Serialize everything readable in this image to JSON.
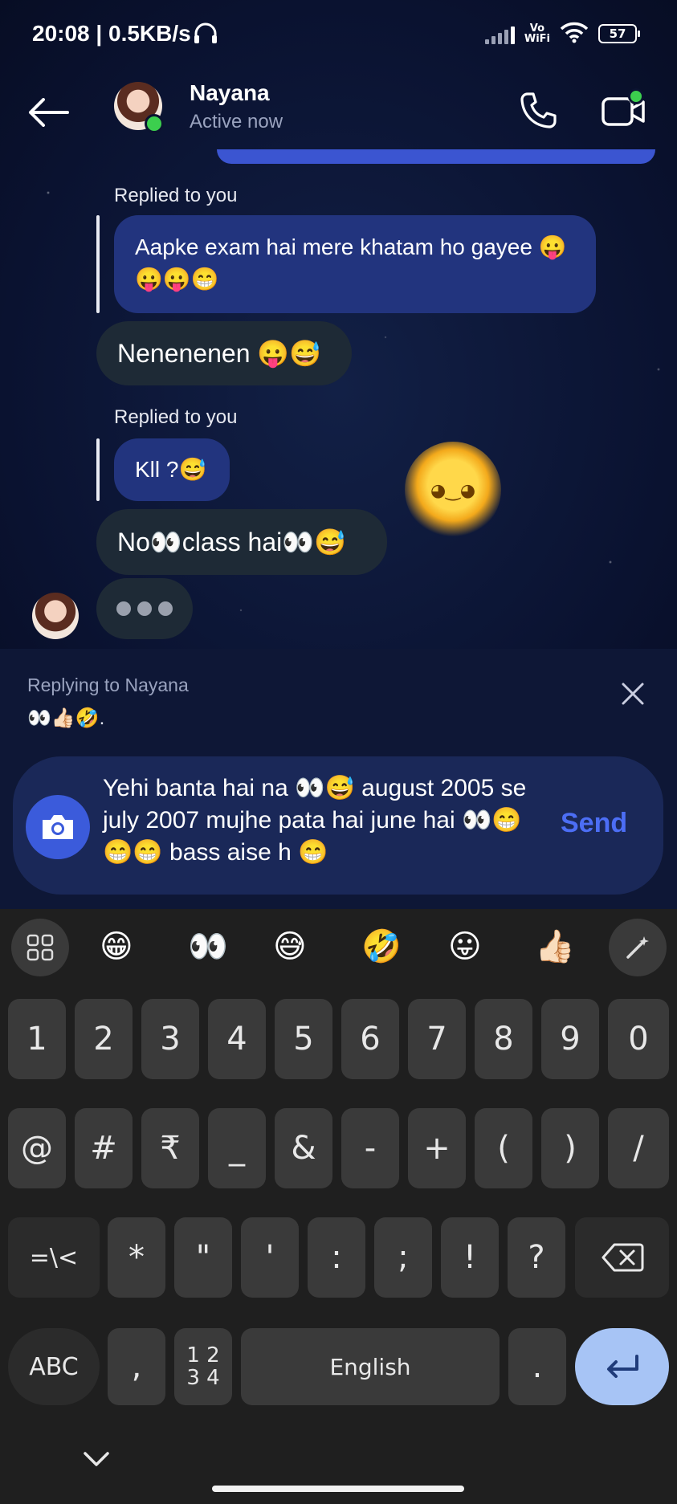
{
  "status_bar": {
    "time": "20:08 | 0.5KB/s",
    "vowifi_top": "Vo",
    "vowifi_bottom": "WiFi",
    "battery": "57"
  },
  "header": {
    "contact_name": "Nayana",
    "contact_status": "Active now"
  },
  "messages": [
    {
      "replied_label": "Replied to you",
      "text": "Aapke exam hai mere khatam ho gayee 😛😛😛😁"
    },
    {
      "text": "Nenenenen 😛😅"
    },
    {
      "replied_label": "Replied to you",
      "text": "Kll ?😅"
    },
    {
      "text": "No👀class hai👀😅"
    }
  ],
  "reply_panel": {
    "title": "Replying to Nayana",
    "preview": "👀👍🏻🤣."
  },
  "composer": {
    "text": "Yehi banta hai na 👀😅 august 2005 se july 2007 mujhe pata hai june hai 👀😁😁😁 bass aise h 😁",
    "send_label": "Send"
  },
  "keyboard": {
    "emoji_suggestions": [
      "😁",
      "👀",
      "😅",
      "🤣",
      "😛",
      "👍🏻"
    ],
    "row_numbers": [
      "1",
      "2",
      "3",
      "4",
      "5",
      "6",
      "7",
      "8",
      "9",
      "0"
    ],
    "row_symbols": [
      "@",
      "#",
      "₹",
      "_",
      "&",
      "-",
      "+",
      "(",
      ")",
      "/"
    ],
    "row_symbols2": [
      "*",
      "\"",
      "'",
      ":",
      ";",
      "!",
      "?"
    ],
    "shift_symbols": "=\\<",
    "abc": "ABC",
    "comma": ",",
    "num_top": "1 2",
    "num_bottom": "3 4",
    "space": "English",
    "period": "."
  }
}
